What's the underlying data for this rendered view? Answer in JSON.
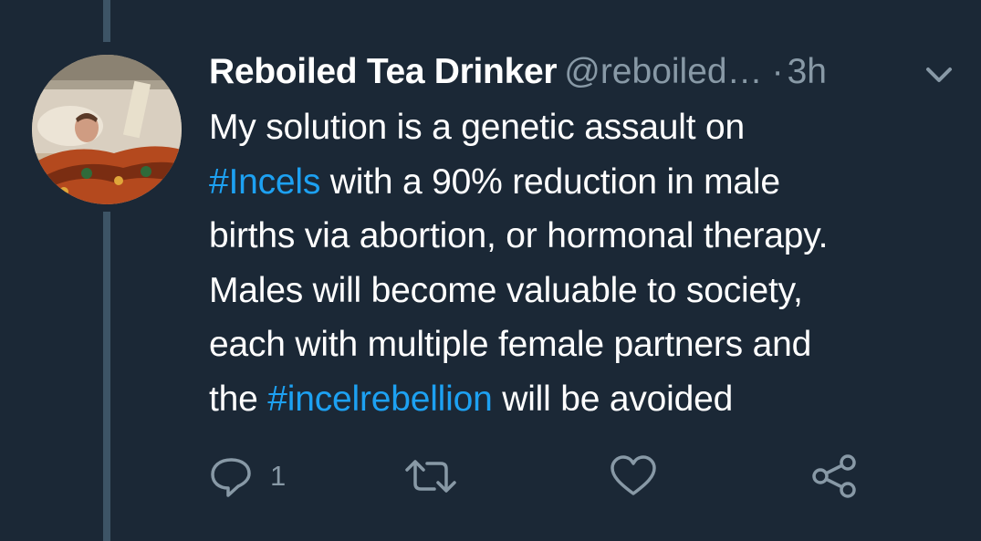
{
  "tweet": {
    "author_name": "Reboiled Tea Drinker",
    "author_handle": "@reboiled…",
    "separator": "·",
    "timestamp": "3h",
    "text_lines": [
      [
        {
          "text": "My solution is a genetic assault on",
          "hashtag": false
        }
      ],
      [
        {
          "text": "#Incels",
          "hashtag": true
        },
        {
          "text": " with a 90% reduction in male",
          "hashtag": false
        }
      ],
      [
        {
          "text": "births via abortion, or hormonal therapy.",
          "hashtag": false
        }
      ],
      [
        {
          "text": "Males will become valuable to society,",
          "hashtag": false
        }
      ],
      [
        {
          "text": "each with multiple female partners and",
          "hashtag": false
        }
      ],
      [
        {
          "text": "the ",
          "hashtag": false
        },
        {
          "text": "#incelrebellion",
          "hashtag": true
        },
        {
          "text": " will be avoided",
          "hashtag": false
        }
      ]
    ]
  },
  "actions": {
    "reply_icon": "reply-bubble-icon",
    "reply_count": "1",
    "retweet_icon": "retweet-icon",
    "like_icon": "heart-icon",
    "share_icon": "share-icon"
  },
  "menu": {
    "caret_icon": "chevron-down-icon"
  },
  "colors": {
    "background": "#1b2836",
    "text": "#ffffff",
    "muted": "#8899a6",
    "hashtag": "#1da1f2",
    "thread_line": "#3d5466"
  }
}
